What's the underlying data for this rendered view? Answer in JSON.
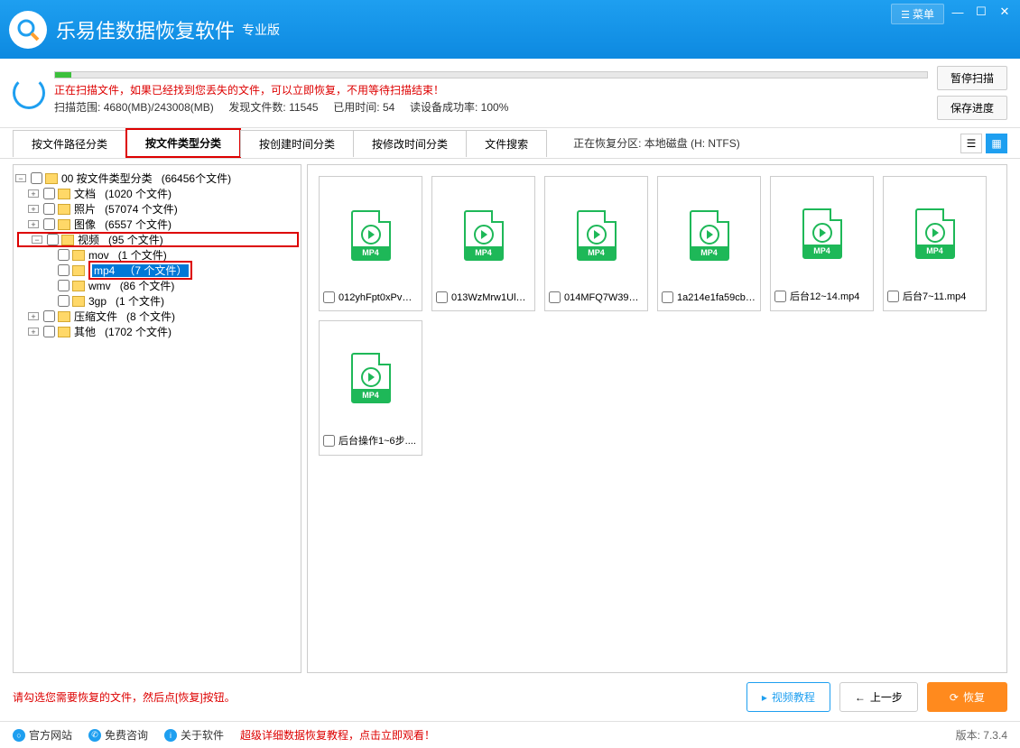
{
  "titlebar": {
    "app_name": "乐易佳数据恢复软件",
    "edition": "专业版",
    "menu_label": "菜单"
  },
  "status": {
    "scanning_msg": "正在扫描文件，如果已经找到您丢失的文件，可以立即恢复，不用等待扫描结束！",
    "scan_range_label": "扫描范围:",
    "scan_range_value": "4680(MB)/243008(MB)",
    "found_files_label": "发现文件数:",
    "found_files_value": "11545",
    "elapsed_label": "已用时间:",
    "elapsed_value": "54",
    "read_label": "读设备成功率:",
    "read_value": "100%",
    "pause_btn": "暂停扫描",
    "save_btn": "保存进度"
  },
  "tabs": {
    "t1": "按文件路径分类",
    "t2": "按文件类型分类",
    "t3": "按创建时间分类",
    "t4": "按修改时间分类",
    "t5": "文件搜索",
    "partition_label": "正在恢复分区:",
    "partition_value": "本地磁盘 (H: NTFS)"
  },
  "tree": {
    "root": "00 按文件类型分类",
    "root_count": "(66456个文件)",
    "n_doc": "文档",
    "n_doc_c": "(1020 个文件)",
    "n_photo": "照片",
    "n_photo_c": "(57074 个文件)",
    "n_image": "图像",
    "n_image_c": "(6557 个文件)",
    "n_video": "视频",
    "n_video_c": "(95 个文件)",
    "n_mov": "mov",
    "n_mov_c": "(1 个文件)",
    "n_mp4": "mp4",
    "n_mp4_c": "（7 个文件）",
    "n_wmv": "wmv",
    "n_wmv_c": "(86 个文件)",
    "n_3gp": "3gp",
    "n_3gp_c": "(1 个文件)",
    "n_zip": "压缩文件",
    "n_zip_c": "(8 个文件)",
    "n_other": "其他",
    "n_other_c": "(1702 个文件)"
  },
  "files": [
    {
      "name": "012yhFpt0xPvGk..."
    },
    {
      "name": "013WzMrw1Uly1K..."
    },
    {
      "name": "014MFQ7W39yZX..."
    },
    {
      "name": "1a214e1fa59cb9..."
    },
    {
      "name": "后台12~14.mp4"
    },
    {
      "name": "后台7~11.mp4"
    },
    {
      "name": "后台操作1~6步...."
    }
  ],
  "mp4_badge": "MP4",
  "bottom": {
    "hint": "请勾选您需要恢复的文件，然后点[恢复]按钮。",
    "video_tutorial": "视频教程",
    "prev": "上一步",
    "recover": "恢复"
  },
  "footer": {
    "link1": "官方网站",
    "link2": "免费咨询",
    "link3": "关于软件",
    "promo": "超级详细数据恢复教程，点击立即观看！",
    "version_label": "版本:",
    "version_value": "7.3.4"
  }
}
